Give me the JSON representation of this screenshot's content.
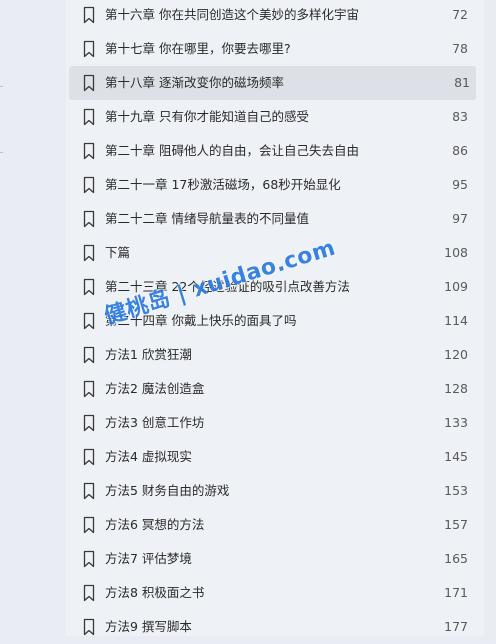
{
  "toc": {
    "items": [
      {
        "title": "第十六章 你在共同创造这个美妙的多样化宇宙",
        "page": "72"
      },
      {
        "title": "第十七章 你在哪里，你要去哪里?",
        "page": "78"
      },
      {
        "title": "第十八章 逐渐改变你的磁场频率",
        "page": "81",
        "selected": true
      },
      {
        "title": "第十九章 只有你才能知道自己的感受",
        "page": "83"
      },
      {
        "title": "第二十章 阻碍他人的自由，会让自己失去自由",
        "page": "86"
      },
      {
        "title": "第二十一章 17秒激活磁场，68秒开始显化",
        "page": "95"
      },
      {
        "title": "第二十二章 情绪导航量表的不同量值",
        "page": "97"
      },
      {
        "title": "下篇",
        "page": "108"
      },
      {
        "title": "第二十三章 22个经过验证的吸引点改善方法",
        "page": "109"
      },
      {
        "title": "第二十四章 你戴上快乐的面具了吗",
        "page": "114"
      },
      {
        "title": "方法1 欣赏狂潮",
        "page": "120"
      },
      {
        "title": "方法2 魔法创造盒",
        "page": "128"
      },
      {
        "title": "方法3 创意工作坊",
        "page": "133"
      },
      {
        "title": "方法4 虚拟现实",
        "page": "145"
      },
      {
        "title": "方法5 财务自由的游戏",
        "page": "153"
      },
      {
        "title": "方法6 冥想的方法",
        "page": "157"
      },
      {
        "title": "方法7 评估梦境",
        "page": "165"
      },
      {
        "title": "方法8 积极面之书",
        "page": "171"
      },
      {
        "title": "方法9 撰写脚本",
        "page": "177"
      }
    ]
  },
  "watermark": {
    "text": "健桃岛 | xuidao.com"
  },
  "colors": {
    "panel_bg": "#eef1f5",
    "selected_bg": "#dde1e7",
    "watermark": "#2b79e0"
  }
}
